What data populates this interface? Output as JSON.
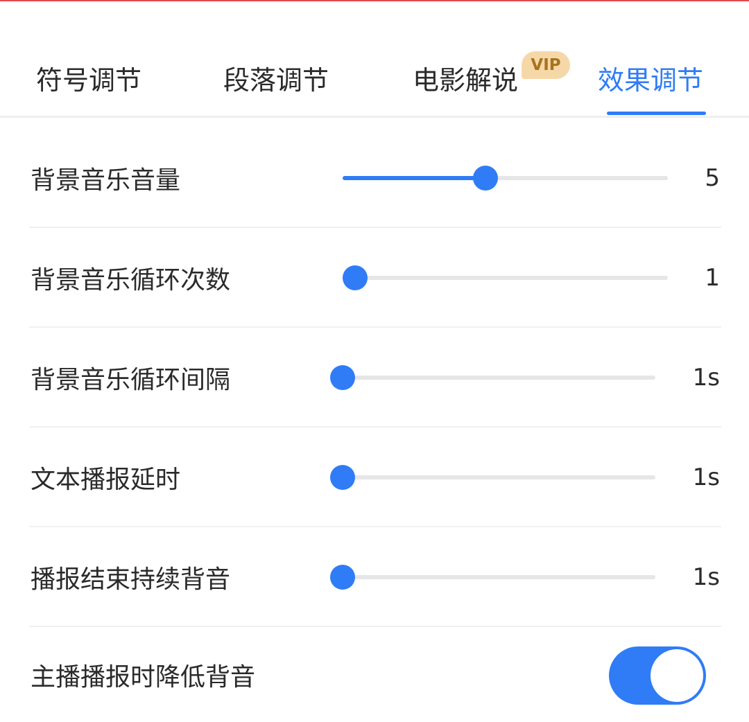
{
  "tabs": [
    {
      "label": "符号调节",
      "active": false
    },
    {
      "label": "段落调节",
      "active": false
    },
    {
      "label": "电影解说",
      "active": false,
      "badge": "VIP"
    },
    {
      "label": "效果调节",
      "active": true
    }
  ],
  "colors": {
    "accent": "#2f7cf6",
    "vip_bg": "#f6d8a8",
    "vip_text": "#a8731e",
    "rail": "#e6e6e6"
  },
  "settings": [
    {
      "label": "背景音乐音量",
      "value_text": "5",
      "level": 0.44
    },
    {
      "label": "背景音乐循环次数",
      "value_text": "1",
      "level": 0.0
    },
    {
      "label": "背景音乐循环间隔",
      "value_text": "1s",
      "level": 0.0
    },
    {
      "label": "文本播报延时",
      "value_text": "1s",
      "level": 0.0
    },
    {
      "label": "播报结束持续背音",
      "value_text": "1s",
      "level": 0.0
    }
  ],
  "toggle_setting": {
    "label": "主播播报时降低背音",
    "on": true
  }
}
